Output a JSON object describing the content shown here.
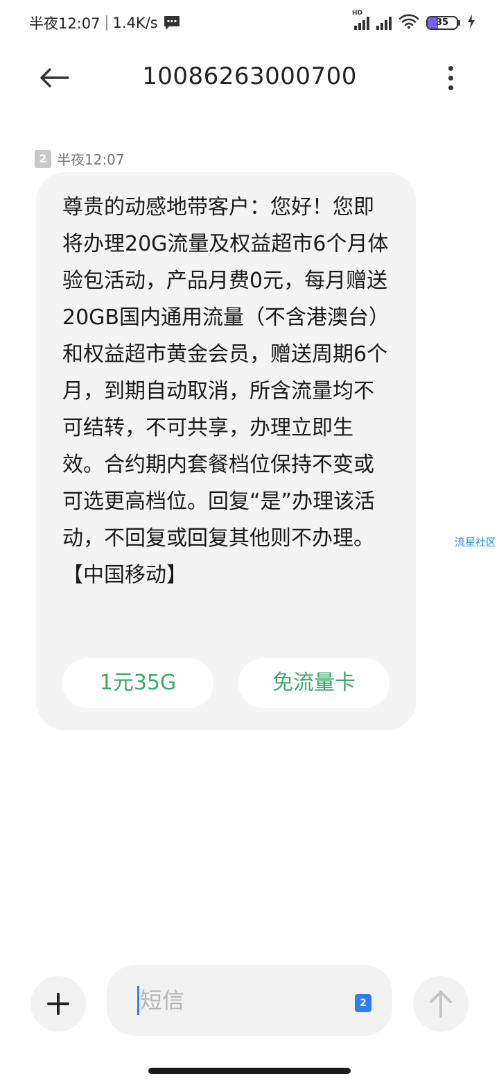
{
  "status_bar": {
    "time": "半夜12:07",
    "speed": "1.4K/s",
    "network_label": "HD",
    "battery_level": "35",
    "battery_fraction": 0.35
  },
  "header": {
    "title": "10086263000700"
  },
  "message": {
    "sim_slot": "2",
    "timestamp": "半夜12:07",
    "body": "尊贵的动感地带客户：您好！您即将办理20G流量及权益超市6个月体验包活动，产品月费0元，每月赠送20GB国内通用流量（不含港澳台）和权益超市黄金会员，赠送周期6个月，到期自动取消，所含流量均不可结转，不可共享，办理立即生效。合约期内套餐档位保持不变或可选更高档位。回复“是”办理该活动，不回复或回复其他则不办理。【中国移动】",
    "quick_replies": [
      "1元35G",
      "免流量卡"
    ]
  },
  "watermark": "流星社区",
  "composer": {
    "placeholder": "短信",
    "sim_slot": "2"
  },
  "colors": {
    "bubble": "#f4f4f4",
    "chip_text": "#3aaa6a",
    "accent_blue": "#2f7cf6",
    "battery_fill": "#7b5cff"
  }
}
